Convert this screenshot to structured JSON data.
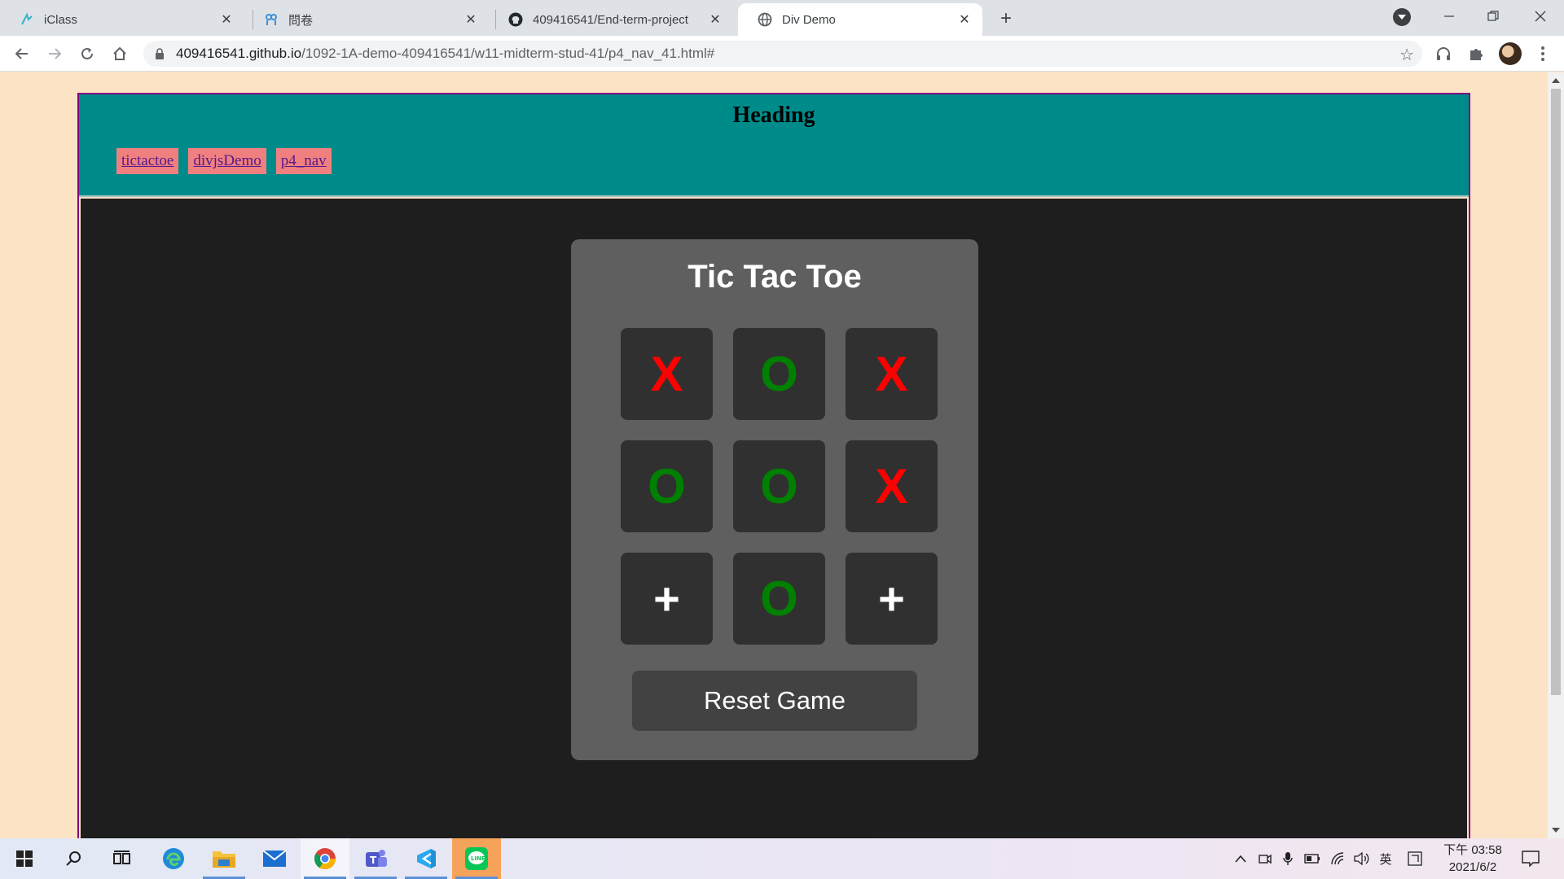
{
  "browser": {
    "tabs": [
      {
        "title": "iClass",
        "icon": "iclass-icon",
        "active": false
      },
      {
        "title": "問卷",
        "icon": "survey-icon",
        "active": false
      },
      {
        "title": "409416541/End-term-project",
        "icon": "github-icon",
        "active": false
      },
      {
        "title": "Div Demo",
        "icon": "globe-icon",
        "active": true
      }
    ],
    "url_host": "409416541.github.io",
    "url_path": "/1092-1A-demo-409416541/w11-midterm-stud-41/p4_nav_41.html#"
  },
  "page": {
    "heading": "Heading",
    "nav_links": [
      "tictactoe",
      "divjsDemo",
      "p4_nav"
    ]
  },
  "game": {
    "title": "Tic Tac Toe",
    "cells": [
      "X",
      "O",
      "X",
      "O",
      "O",
      "X",
      "+",
      "O",
      "+"
    ],
    "reset_label": "Reset Game",
    "colors": {
      "x": "#ff0000",
      "o": "#008000",
      "empty": "#ffffff"
    }
  },
  "taskbar": {
    "clock_period": "下午",
    "clock_time": "03:58",
    "clock_date": "2021/6/2",
    "ime_label": "英"
  }
}
